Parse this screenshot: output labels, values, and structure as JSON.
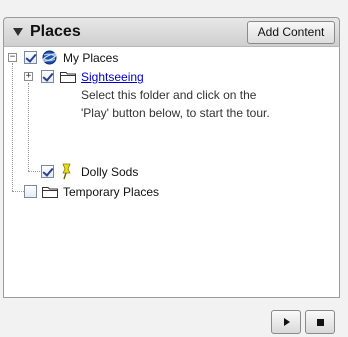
{
  "header": {
    "title": "Places",
    "add_content_label": "Add Content"
  },
  "tree": {
    "my_places": {
      "label": "My Places",
      "checked": true,
      "icon": "globe-icon"
    },
    "sightseeing": {
      "label": "Sightseeing",
      "checked": true,
      "icon": "folder-icon",
      "description_line1": "Select this folder and click on the",
      "description_line2": "'Play' button below, to start the tour."
    },
    "dolly_sods": {
      "label": "Dolly Sods",
      "checked": true,
      "icon": "placemark-pin-icon"
    },
    "temporary_places": {
      "label": "Temporary Places",
      "checked": false,
      "icon": "folder-icon"
    }
  },
  "controls": {
    "play": "play-icon",
    "stop": "stop-icon"
  }
}
